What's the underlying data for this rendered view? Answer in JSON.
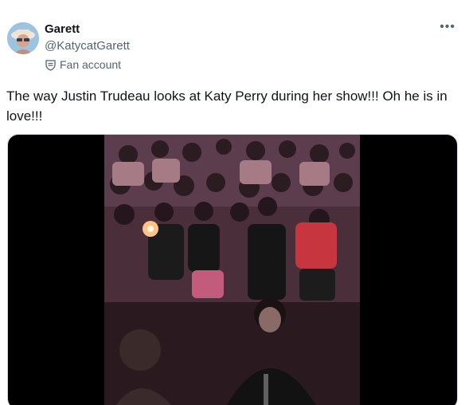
{
  "author": {
    "name": "Garett",
    "handle": "@KatycatGarett",
    "label": "Fan account"
  },
  "tweet": {
    "text": "The way Justin Trudeau looks at Katy Perry during her show!!! Oh he is in love!!!"
  },
  "icons": {
    "more": "more-dots-icon",
    "label": "fan-account-icon"
  },
  "colors": {
    "text": "#0f1419",
    "secondary": "#536471",
    "media_bg": "#000000"
  }
}
